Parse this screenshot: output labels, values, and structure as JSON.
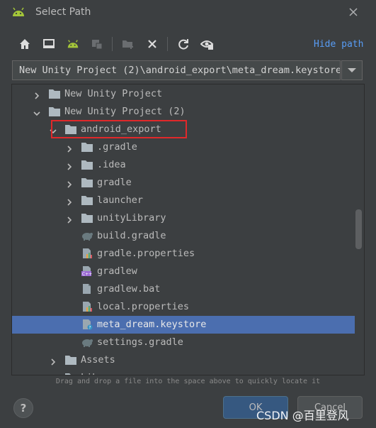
{
  "window": {
    "title": "Select Path",
    "icon": "android-icon"
  },
  "toolbar": {
    "buttons": [
      {
        "name": "home-directory-button",
        "icon": "home-icon"
      },
      {
        "name": "desktop-directory-button",
        "icon": "desktop-icon"
      },
      {
        "name": "project-directory-button",
        "icon": "android-icon"
      },
      {
        "name": "module-directory-button",
        "icon": "module-icon"
      },
      {
        "name": "new-folder-button",
        "icon": "new-folder-icon"
      },
      {
        "name": "delete-button",
        "icon": "delete-icon"
      },
      {
        "name": "refresh-button",
        "icon": "refresh-icon"
      },
      {
        "name": "show-hidden-button",
        "icon": "show-hidden-icon"
      }
    ],
    "hide_path_label": "Hide path"
  },
  "path": {
    "value": "New Unity Project (2)\\android_export\\meta_dream.keystore"
  },
  "tree": {
    "rows": [
      {
        "label": "New Unity Project",
        "type": "folder",
        "expanded": false
      },
      {
        "label": "New Unity Project (2)",
        "type": "folder",
        "expanded": true
      },
      {
        "label": "android_export",
        "type": "folder",
        "expanded": true,
        "highlighted": true
      },
      {
        "label": ".gradle",
        "type": "folder",
        "expanded": false
      },
      {
        "label": ".idea",
        "type": "folder",
        "expanded": false
      },
      {
        "label": "gradle",
        "type": "folder",
        "expanded": false
      },
      {
        "label": "launcher",
        "type": "folder",
        "expanded": false
      },
      {
        "label": "unityLibrary",
        "type": "folder",
        "expanded": false
      },
      {
        "label": "build.gradle",
        "type": "gradle-file"
      },
      {
        "label": "gradle.properties",
        "type": "properties-file"
      },
      {
        "label": "gradlew",
        "type": "shell-file"
      },
      {
        "label": "gradlew.bat",
        "type": "text-file"
      },
      {
        "label": "local.properties",
        "type": "properties-file"
      },
      {
        "label": "meta_dream.keystore",
        "type": "keystore-file",
        "selected": true
      },
      {
        "label": "settings.gradle",
        "type": "gradle-file"
      },
      {
        "label": "Assets",
        "type": "folder",
        "expanded": false
      },
      {
        "label": "Lib",
        "type": "folder",
        "expanded": false
      }
    ]
  },
  "hint": "Drag and drop a file into the space above to quickly locate it",
  "buttons": {
    "help_label": "?",
    "ok_label": "OK",
    "cancel_label": "Cancel"
  },
  "watermark": "CSDN @百里登风",
  "colors": {
    "background": "#3c3f41",
    "selection": "#4b6eaf",
    "link": "#589df6",
    "highlight_box": "#e0282a",
    "android_green": "#a4c639"
  }
}
